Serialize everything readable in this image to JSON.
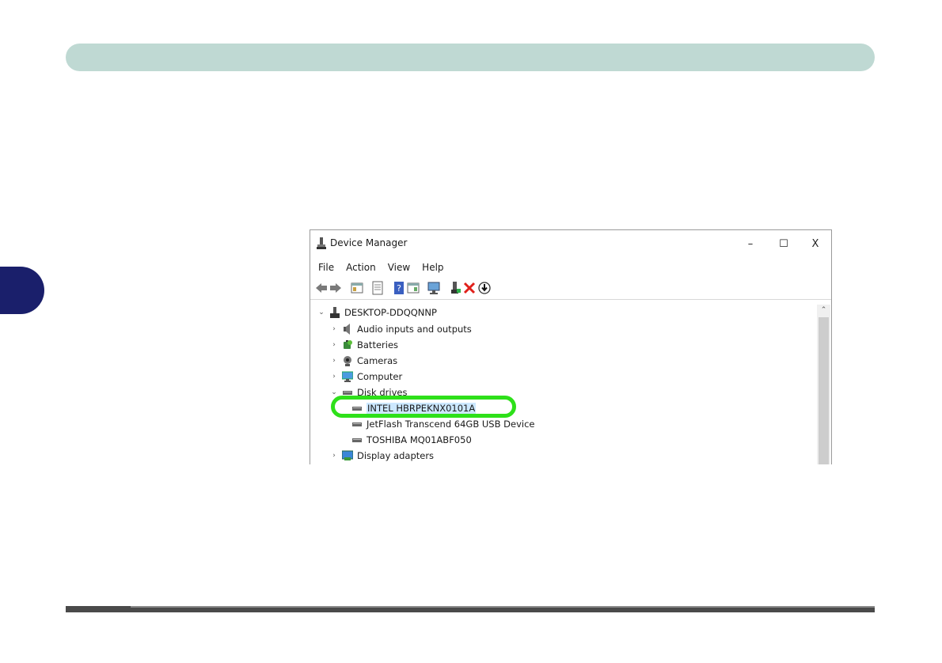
{
  "window": {
    "title": "Device Manager",
    "minimize_glyph": "–",
    "maximize_glyph": "☐",
    "close_glyph": "X"
  },
  "menu": [
    {
      "label": "File"
    },
    {
      "label": "Action"
    },
    {
      "label": "View"
    },
    {
      "label": "Help"
    }
  ],
  "toolbar": [
    {
      "icon": "back-arrow-icon"
    },
    {
      "icon": "forward-arrow-icon"
    },
    {
      "icon": "show-hide-console-tree-icon"
    },
    {
      "icon": "properties-icon"
    },
    {
      "icon": "help-icon"
    },
    {
      "icon": "action-pane-icon"
    },
    {
      "icon": "scan-hardware-changes-icon"
    },
    {
      "icon": "update-driver-icon"
    },
    {
      "icon": "uninstall-device-icon"
    },
    {
      "icon": "disable-device-icon"
    }
  ],
  "tree": {
    "root": {
      "label": "DESKTOP-DDQQNNP",
      "expander": "⌄"
    },
    "items": [
      {
        "label": "Audio inputs and outputs",
        "expander": "›"
      },
      {
        "label": "Batteries",
        "expander": "›"
      },
      {
        "label": "Cameras",
        "expander": "›"
      },
      {
        "label": "Computer",
        "expander": "›"
      },
      {
        "label": "Disk drives",
        "expander": "⌄"
      },
      {
        "label": "INTEL HBRPEKNX0101A",
        "selected": true
      },
      {
        "label": "JetFlash Transcend 64GB USB Device"
      },
      {
        "label": "TOSHIBA MQ01ABF050"
      },
      {
        "label": "Display adapters",
        "expander": "›"
      }
    ]
  },
  "scrollbar": {
    "up_glyph": "⌃"
  },
  "colors": {
    "top_band": "#bfd9d3",
    "side_tab": "#1a1f6b",
    "highlight_ring": "#2ee01a",
    "selected_row": "#cce8ff"
  }
}
